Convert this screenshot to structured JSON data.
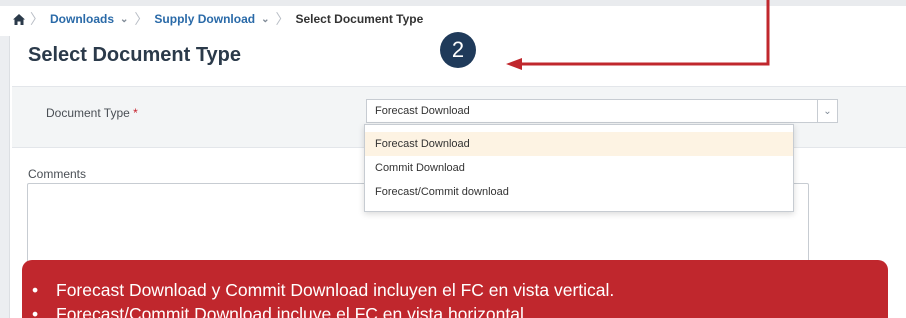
{
  "breadcrumb": {
    "home_icon": "home-icon",
    "items": [
      {
        "label": "Downloads",
        "has_dropdown": true
      },
      {
        "label": "Supply Download",
        "has_dropdown": true
      }
    ],
    "current": "Select Document Type"
  },
  "page": {
    "title": "Select Document Type"
  },
  "annotation": {
    "step_number": "2",
    "color": "#c0272d",
    "bullets": [
      "Forecast Download y Commit Download incluyen el FC en vista vertical.",
      "Forecast/Commit Download incluye el FC en vista horizontal."
    ]
  },
  "form": {
    "document_type_label": "Document Type",
    "required_marker": "*",
    "document_type_value": "Forecast Download",
    "comments_label": "Comments",
    "comments_value": ""
  },
  "dropdown": {
    "options": [
      "Forecast Download",
      "Commit Download",
      "Forecast/Commit download"
    ],
    "highlighted_index": 0
  }
}
